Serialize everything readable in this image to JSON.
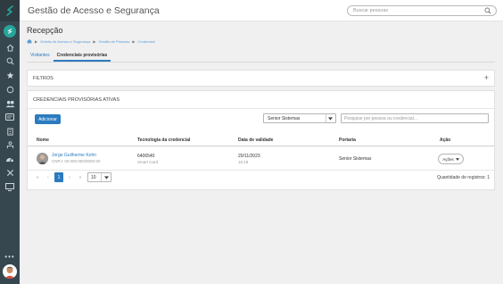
{
  "topbar": {
    "app_title": "Gestão de Acesso e Segurança",
    "search_placeholder": "Buscar pessoas"
  },
  "sidebar": {
    "logo_icon": "s-logo-icon",
    "items": [
      {
        "name": "home",
        "icon": "home-icon"
      },
      {
        "name": "search",
        "icon": "search-icon"
      },
      {
        "name": "favorites",
        "icon": "star-icon"
      },
      {
        "name": "security",
        "icon": "shield-icon"
      },
      {
        "name": "people",
        "icon": "people-icon"
      },
      {
        "name": "badge",
        "icon": "id-card-icon"
      },
      {
        "name": "building",
        "icon": "building-icon"
      },
      {
        "name": "reception",
        "icon": "reception-icon"
      },
      {
        "name": "dashboard",
        "icon": "gauge-icon"
      },
      {
        "name": "tools",
        "icon": "tools-icon"
      },
      {
        "name": "monitor",
        "icon": "monitor-icon"
      }
    ],
    "more": "•••"
  },
  "page": {
    "title": "Recepção",
    "breadcrumb": [
      "Gestão de Acesso e Segurança",
      "Gestão de Pessoas",
      "Credencial"
    ]
  },
  "tabs": [
    {
      "label": "Visitantes",
      "active": false
    },
    {
      "label": "Credenciais provisórias",
      "active": true
    }
  ],
  "filters": {
    "label": "FILTROS",
    "toggle": "+"
  },
  "credentials_panel": {
    "heading": "CREDENCIAIS PROVISÓRIAS ATIVAS",
    "add_button": "Adicionar",
    "portaria_select": "Senior Sistemas",
    "search_placeholder": "Pesquise por pessoa ou credencial...",
    "columns": [
      "Nome",
      "Tecnologia da credencial",
      "Data de validade",
      "Portaria",
      "Ação"
    ],
    "rows": [
      {
        "name": "Jorge Guilherme Kohn",
        "document": "CNPJ: 00.000.000/0000-00",
        "credential_number": "6406540",
        "credential_tech": "Smart Card",
        "valid_date": "20/11/2023",
        "valid_time": "15:18",
        "portaria": "Senior Sistemas",
        "action_label": "Ações"
      }
    ],
    "pagination": {
      "first": "«",
      "prev": "‹",
      "current": "1",
      "next": "›",
      "last": "»",
      "page_size": "10",
      "record_count": "Quantidade de registros: 1"
    }
  },
  "colors": {
    "sidebar": "#37474f",
    "accent": "#2b7bc0",
    "active_icon": "#26a69a"
  }
}
